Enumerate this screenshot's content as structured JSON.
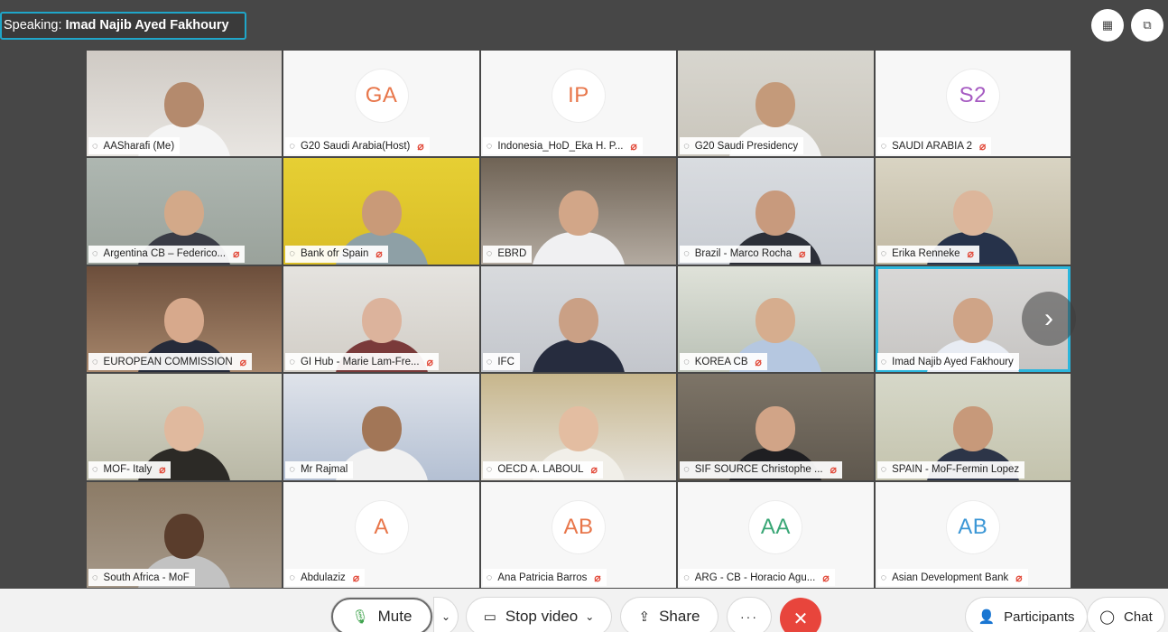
{
  "speaking": {
    "label": "Speaking:",
    "name": "Imad Najib Ayed Fakhoury"
  },
  "icons": {
    "layout": "grid-layout-icon",
    "popout": "pop-out-icon",
    "next": "chevron-right-icon"
  },
  "colors": {
    "active_border": "#2bb6dc",
    "mic_off": "#e24b3b",
    "leave": "#e8453c",
    "mic_on": "#3fa34d"
  },
  "participants": [
    {
      "name": "AASharafi (Me)",
      "type": "video",
      "c1": "#cfcac4",
      "c2": "#e8e5e1",
      "skin": "#b48a6d",
      "shirt": "#f5f5f5",
      "muted": false,
      "active": false
    },
    {
      "name": "G20 Saudi Arabia(Host)",
      "type": "avatar",
      "initials": "GA",
      "color": "#e8764a",
      "muted": true,
      "active": false
    },
    {
      "name": "Indonesia_HoD_Eka H. P...",
      "type": "avatar",
      "initials": "IP",
      "color": "#e8764a",
      "muted": true,
      "active": false
    },
    {
      "name": "G20 Saudi Presidency",
      "type": "video",
      "c1": "#d8d6cf",
      "c2": "#c9c5bb",
      "skin": "#c49a7a",
      "shirt": "#f3f3f3",
      "muted": false,
      "active": false
    },
    {
      "name": "SAUDI ARABIA 2",
      "type": "avatar",
      "initials": "S2",
      "color": "#a65bc2",
      "muted": true,
      "active": false
    },
    {
      "name": "Argentina CB – Federico...",
      "type": "video",
      "c1": "#aeb7b1",
      "c2": "#9aa29b",
      "skin": "#d3a989",
      "shirt": "#3a3c46",
      "muted": true,
      "active": false
    },
    {
      "name": "Bank ofr Spain",
      "type": "video",
      "c1": "#e6cf34",
      "c2": "#d9bd26",
      "skin": "#c99a78",
      "shirt": "#8ea0a6",
      "muted": true,
      "active": false
    },
    {
      "name": "EBRD",
      "type": "video",
      "c1": "#6f6355",
      "c2": "#b3aaa0",
      "skin": "#d2a688",
      "shirt": "#f0f0f2",
      "muted": false,
      "active": false
    },
    {
      "name": "Brazil - Marco Rocha",
      "type": "video",
      "c1": "#d9dce0",
      "c2": "#c7cbd1",
      "skin": "#c89a7d",
      "shirt": "#2c2f38",
      "muted": true,
      "active": false
    },
    {
      "name": "Erika Renneke",
      "type": "video",
      "c1": "#d9d4c3",
      "c2": "#c1b9a3",
      "skin": "#dcb69b",
      "shirt": "#26324a",
      "muted": true,
      "active": false
    },
    {
      "name": "EUROPEAN COMMISSION",
      "type": "video",
      "c1": "#6c4e3b",
      "c2": "#a7876c",
      "skin": "#d7a98c",
      "shirt": "#262b3a",
      "muted": true,
      "active": false
    },
    {
      "name": "GI Hub - Marie Lam-Fre...",
      "type": "video",
      "c1": "#e5e3df",
      "c2": "#d1cdc6",
      "skin": "#dcb39c",
      "shirt": "#7a3a3a",
      "muted": true,
      "active": false
    },
    {
      "name": "IFC",
      "type": "video",
      "c1": "#d8dadd",
      "c2": "#c3c6cc",
      "skin": "#caa085",
      "shirt": "#262c3e",
      "muted": false,
      "active": false
    },
    {
      "name": "KOREA CB",
      "type": "video",
      "c1": "#dfe2d9",
      "c2": "#b9c0b5",
      "skin": "#d6ad8e",
      "shirt": "#b5c7e0",
      "muted": true,
      "active": false
    },
    {
      "name": "Imad Najib Ayed Fakhoury",
      "type": "video",
      "c1": "#d9d8d7",
      "c2": "#c6c4c2",
      "skin": "#cfa487",
      "shirt": "#e8ecf3",
      "muted": false,
      "active": true
    },
    {
      "name": "MOF- Italy",
      "type": "video",
      "c1": "#d8d7c8",
      "c2": "#b9b8a6",
      "skin": "#e0b99e",
      "shirt": "#2c2a26",
      "muted": true,
      "active": false
    },
    {
      "name": "Mr Rajmal",
      "type": "video",
      "c1": "#dfe3ea",
      "c2": "#b4c0d3",
      "skin": "#a27657",
      "shirt": "#f1f1f1",
      "muted": false,
      "active": false
    },
    {
      "name": "OECD A. LABOUL",
      "type": "video",
      "c1": "#c7b68c",
      "c2": "#e6e3dc",
      "skin": "#e3bda1",
      "shirt": "#f1efe9",
      "muted": true,
      "active": false
    },
    {
      "name": "SIF SOURCE Christophe ...",
      "type": "video",
      "c1": "#7d7467",
      "c2": "#5f584e",
      "skin": "#d1a487",
      "shirt": "#1f1f22",
      "muted": true,
      "active": false
    },
    {
      "name": "SPAIN - MoF-Fermin Lopez",
      "type": "video",
      "c1": "#d6d8c9",
      "c2": "#c4c3ad",
      "skin": "#c7997a",
      "shirt": "#2d3548",
      "muted": false,
      "active": false
    },
    {
      "name": "South Africa - MoF",
      "type": "video",
      "c1": "#8c7b66",
      "c2": "#a59889",
      "skin": "#5a3d2c",
      "shirt": "#c2c2c2",
      "muted": false,
      "active": false
    },
    {
      "name": "Abdulaziz",
      "type": "avatar",
      "initials": "A",
      "color": "#e8764a",
      "muted": true,
      "active": false
    },
    {
      "name": "Ana Patricia Barros",
      "type": "avatar",
      "initials": "AB",
      "color": "#e8764a",
      "muted": true,
      "active": false
    },
    {
      "name": "ARG - CB - Horacio Agu...",
      "type": "avatar",
      "initials": "AA",
      "color": "#3aa776",
      "muted": true,
      "active": false
    },
    {
      "name": "Asian Development Bank",
      "type": "avatar",
      "initials": "AB",
      "color": "#3c97d6",
      "muted": true,
      "active": false
    }
  ],
  "toolbar": {
    "mute_label": "Mute",
    "mute_caret": "⌄",
    "video_label": "Stop video",
    "share_label": "Share",
    "more_label": "···",
    "leave_label": "✕",
    "participants_label": "Participants",
    "chat_label": "Chat"
  }
}
